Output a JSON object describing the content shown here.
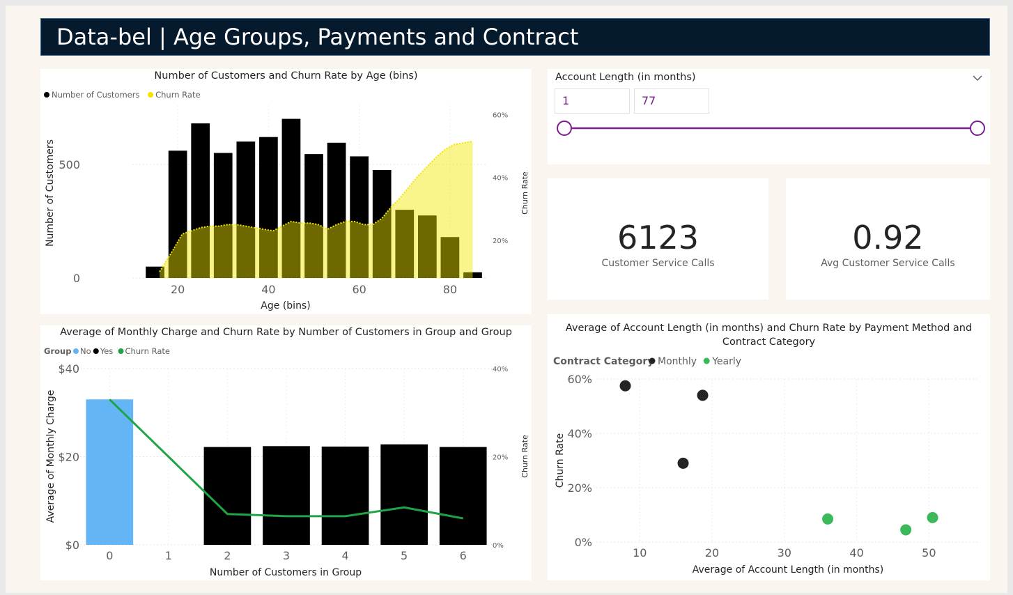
{
  "title": "Data-bel | Age Groups, Payments and Contract",
  "colors": {
    "header_bg": "#061a2e",
    "black": "#000000",
    "yellow": "#f2e600",
    "blue": "#64b5f6",
    "green": "#1fa446",
    "slider": "#7b1d8f",
    "dark_point": "#252423",
    "green_point": "#3cb95b"
  },
  "age_chart": {
    "title": "Number of Customers and Churn Rate by Age (bins)",
    "legend": [
      {
        "label": "Number of Customers",
        "color": "#000000"
      },
      {
        "label": "Churn Rate",
        "color": "#f2e600"
      }
    ],
    "ylabel": "Number of Customers",
    "y2label": "Churn Rate",
    "xlabel": "Age (bins)",
    "y_ticks": [
      "500",
      "0"
    ],
    "y2_ticks": [
      "60%",
      "40%",
      "20%"
    ],
    "x_ticks": [
      "20",
      "40",
      "60",
      "80"
    ]
  },
  "slicer": {
    "title": "Account Length (in months)",
    "min_value": "1",
    "max_value": "77",
    "range": [
      1,
      77
    ],
    "chevron_icon": "chevron-down-icon"
  },
  "kpis": [
    {
      "value": "6123",
      "label": "Customer Service Calls"
    },
    {
      "value": "0.92",
      "label": "Avg Customer Service Calls"
    }
  ],
  "group_chart": {
    "title": "Average of Monthly Charge and Churn Rate by Number of Customers in Group and Group",
    "legend_title": "Group",
    "legend": [
      {
        "label": "No",
        "color": "#64b5f6"
      },
      {
        "label": "Yes",
        "color": "#000000"
      },
      {
        "label": "Churn Rate",
        "color": "#1fa446"
      }
    ],
    "ylabel": "Average of Monthly Charge",
    "y2label": "Churn Rate",
    "xlabel": "Number of Customers in Group",
    "y_ticks": [
      "$40",
      "$20",
      "$0"
    ],
    "y2_ticks": [
      "40%",
      "20%",
      "0%"
    ],
    "x_ticks": [
      "0",
      "1",
      "2",
      "3",
      "4",
      "5",
      "6"
    ]
  },
  "scatter_chart": {
    "title": "Average of Account Length (in months) and Churn Rate by Payment Method and Contract Category",
    "legend_title": "Contract Category",
    "legend": [
      {
        "label": "Monthly",
        "color": "#252423"
      },
      {
        "label": "Yearly",
        "color": "#3cb95b"
      }
    ],
    "ylabel": "Churn Rate",
    "xlabel": "Average of Account Length (in months)",
    "y_ticks": [
      "60%",
      "40%",
      "20%",
      "0%"
    ],
    "x_ticks": [
      "10",
      "20",
      "30",
      "40",
      "50"
    ]
  },
  "chart_data": [
    {
      "type": "bar",
      "title": "Number of Customers and Churn Rate by Age (bins)",
      "xlabel": "Age (bins)",
      "ylabel": "Number of Customers",
      "y2label": "Churn Rate",
      "x": [
        15,
        20,
        25,
        30,
        35,
        40,
        45,
        50,
        55,
        60,
        65,
        70,
        75,
        80,
        85
      ],
      "series": [
        {
          "name": "Number of Customers",
          "type": "bar",
          "values": [
            50,
            560,
            680,
            550,
            600,
            620,
            700,
            545,
            595,
            535,
            475,
            300,
            275,
            180,
            25
          ]
        },
        {
          "name": "Churn Rate",
          "type": "area",
          "axis": "secondary",
          "x": [
            16,
            19,
            21,
            23,
            25,
            27,
            29,
            31,
            33,
            35,
            37,
            39,
            41,
            43,
            45,
            47,
            49,
            51,
            53,
            55,
            57,
            59,
            61,
            63,
            65,
            67,
            69,
            71,
            73,
            75,
            77,
            79,
            81,
            83,
            85
          ],
          "values": [
            0.1,
            0.17,
            0.22,
            0.23,
            0.24,
            0.245,
            0.245,
            0.25,
            0.25,
            0.245,
            0.24,
            0.235,
            0.23,
            0.245,
            0.26,
            0.255,
            0.255,
            0.25,
            0.235,
            0.25,
            0.26,
            0.26,
            0.25,
            0.25,
            0.27,
            0.305,
            0.335,
            0.37,
            0.405,
            0.435,
            0.465,
            0.49,
            0.505,
            0.51,
            0.515
          ]
        }
      ],
      "ylim": [
        0,
        760
      ],
      "y2lim": [
        0.08,
        0.63
      ]
    },
    {
      "type": "bar",
      "title": "Average of Monthly Charge and Churn Rate by Number of Customers in Group and Group",
      "xlabel": "Number of Customers in Group",
      "ylabel": "Average of Monthly Charge",
      "y2label": "Churn Rate",
      "categories": [
        "0",
        "1",
        "2",
        "3",
        "4",
        "5",
        "6"
      ],
      "series": [
        {
          "name": "No",
          "type": "bar",
          "values": [
            33,
            null,
            null,
            null,
            null,
            null,
            null
          ]
        },
        {
          "name": "Yes",
          "type": "bar",
          "values": [
            null,
            null,
            22.2,
            22.4,
            22.3,
            22.8,
            22.2
          ]
        },
        {
          "name": "Churn Rate",
          "type": "line",
          "axis": "secondary",
          "values": [
            0.33,
            null,
            0.07,
            0.065,
            0.065,
            0.085,
            0.06
          ]
        }
      ],
      "ylim": [
        0,
        40
      ],
      "y2lim": [
        0,
        0.4
      ]
    },
    {
      "type": "scatter",
      "title": "Average of Account Length (in months) and Churn Rate by Payment Method and Contract Category",
      "xlabel": "Average of Account Length (in months)",
      "ylabel": "Churn Rate",
      "series": [
        {
          "name": "Monthly",
          "points": [
            {
              "x": 8,
              "y": 0.575
            },
            {
              "x": 16,
              "y": 0.29
            },
            {
              "x": 18.7,
              "y": 0.54
            }
          ]
        },
        {
          "name": "Yearly",
          "points": [
            {
              "x": 36,
              "y": 0.085
            },
            {
              "x": 46.8,
              "y": 0.045
            },
            {
              "x": 50.5,
              "y": 0.09
            }
          ]
        }
      ],
      "xlim": [
        4,
        57
      ],
      "ylim": [
        0,
        0.6
      ]
    }
  ]
}
